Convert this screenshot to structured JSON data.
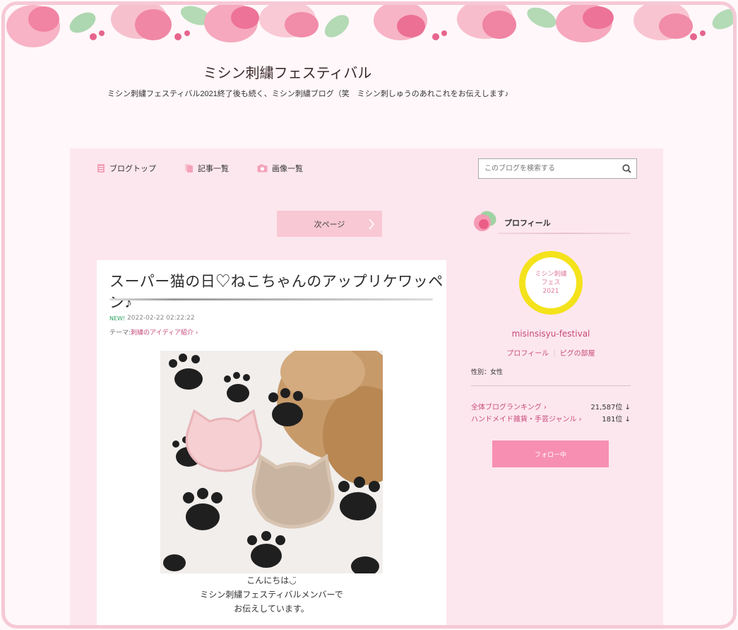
{
  "header": {
    "title": "ミシン刺繍フェスティバル",
    "description": "ミシン刺繍フェスティバル2021終了後も続く、ミシン刺繍ブログ（笑　ミシン刺しゅうのあれこれをお伝えします♪"
  },
  "nav": {
    "items": [
      {
        "label": "ブログトップ",
        "icon": "document-icon"
      },
      {
        "label": "記事一覧",
        "icon": "copy-icon"
      },
      {
        "label": "画像一覧",
        "icon": "camera-icon"
      }
    ],
    "search_placeholder": "このブログを検索する"
  },
  "pager": {
    "next_label": "次ページ"
  },
  "article": {
    "title": "スーパー猫の日♡ねこちゃんのアップリケワッペン♪",
    "new_badge": "NEW!",
    "date": "2022-02-22 02:22:22",
    "theme_prefix": "テーマ:",
    "theme_link": "刺繍のアイディア紹介 ›",
    "text_lines": [
      "こんにちは◡̈",
      "ミシン刺繍フェスティバルメンバーで",
      "お伝えしています。"
    ]
  },
  "sidebar": {
    "profile_heading": "プロフィール",
    "avatar_text": [
      "ミシン刺繍",
      "フェス",
      "2021"
    ],
    "username": "misinsisyu-festival",
    "profile_link": "プロフィール",
    "room_link": "ピグの部屋",
    "gender": "性別：女性",
    "rankings": [
      {
        "label": "全体ブログランキング ›",
        "value": "21,587位 ↓"
      },
      {
        "label": "ハンドメイド雑貨・手芸ジャンル ›",
        "value": "181位 ↓"
      }
    ],
    "follow_label": "フォロー中"
  },
  "colors": {
    "accent_pink": "#f78fb3",
    "link_pink": "#c84a7a",
    "main_bg": "#fde7ee",
    "avatar_yellow": "#f4e21b"
  }
}
